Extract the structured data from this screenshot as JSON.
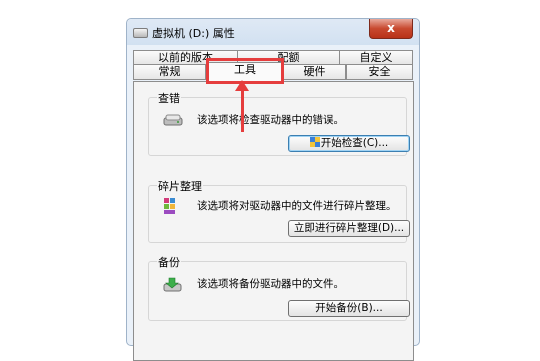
{
  "window": {
    "title": "虚拟机 (D:) 属性",
    "close_glyph": "x"
  },
  "tabs": {
    "row1": [
      "以前的版本",
      "配额",
      "自定义"
    ],
    "row2": [
      "常规",
      "工具",
      "硬件",
      "安全"
    ],
    "active": "工具"
  },
  "groups": {
    "check": {
      "title": "查错",
      "description": "该选项将检查驱动器中的错误。",
      "button_label": "开始检查(C)..."
    },
    "defrag": {
      "title": "碎片整理",
      "description": "该选项将对驱动器中的文件进行碎片整理。",
      "button_label": "立即进行碎片整理(D)..."
    },
    "backup": {
      "title": "备份",
      "description": "该选项将备份驱动器中的文件。",
      "button_label": "开始备份(B)..."
    }
  },
  "annotation": {
    "color": "#e53d3d"
  }
}
